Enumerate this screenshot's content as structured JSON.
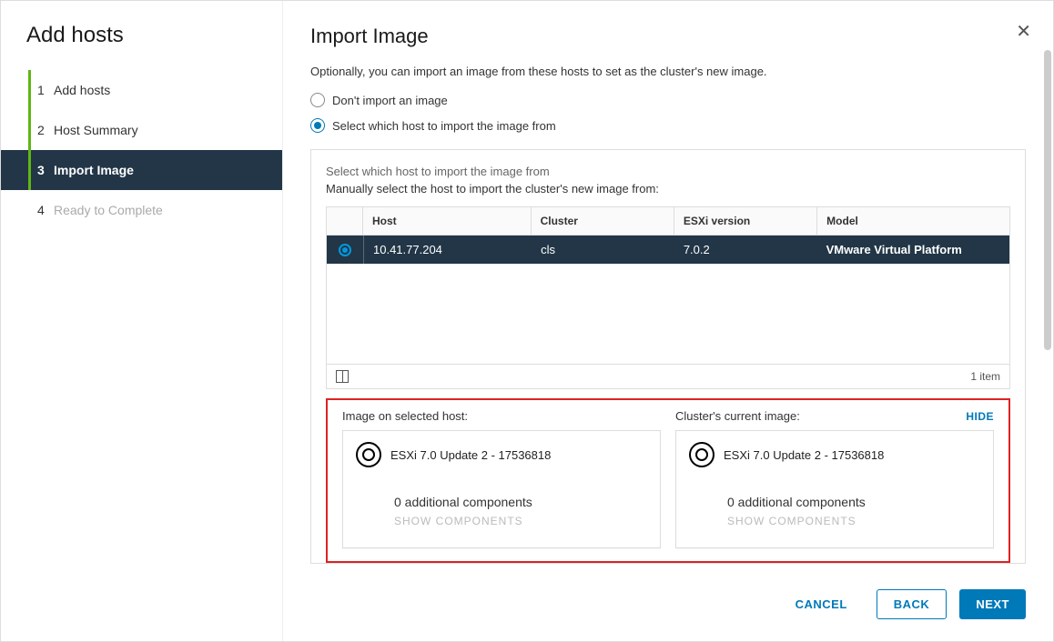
{
  "wizard": {
    "title": "Add hosts"
  },
  "steps": [
    {
      "num": "1",
      "label": "Add hosts"
    },
    {
      "num": "2",
      "label": "Host Summary"
    },
    {
      "num": "3",
      "label": "Import Image"
    },
    {
      "num": "4",
      "label": "Ready to Complete"
    }
  ],
  "page": {
    "title": "Import Image",
    "intro": "Optionally, you can import an image from these hosts to set as the cluster's new image.",
    "opt_no_import": "Don't import an image",
    "opt_select": "Select which host to import the image from"
  },
  "panel": {
    "title": "Select which host to import the image from",
    "sub": "Manually select the host to import the cluster's new image from:"
  },
  "grid": {
    "headers": {
      "host": "Host",
      "cluster": "Cluster",
      "ver": "ESXi version",
      "model": "Model"
    },
    "row": {
      "host": "10.41.77.204",
      "cluster": "cls",
      "ver": "7.0.2",
      "model": "VMware Virtual Platform"
    },
    "footer_count": "1 item"
  },
  "images": {
    "left_label": "Image on selected host:",
    "right_label": "Cluster's current image:",
    "hide": "HIDE",
    "host_image": {
      "title": "ESXi 7.0 Update 2 - 17536818",
      "components": "0 additional components",
      "show": "SHOW COMPONENTS"
    },
    "cluster_image": {
      "title": "ESXi 7.0 Update 2 - 17536818",
      "components": "0 additional components",
      "show": "SHOW COMPONENTS"
    }
  },
  "buttons": {
    "cancel": "CANCEL",
    "back": "BACK",
    "next": "NEXT"
  }
}
